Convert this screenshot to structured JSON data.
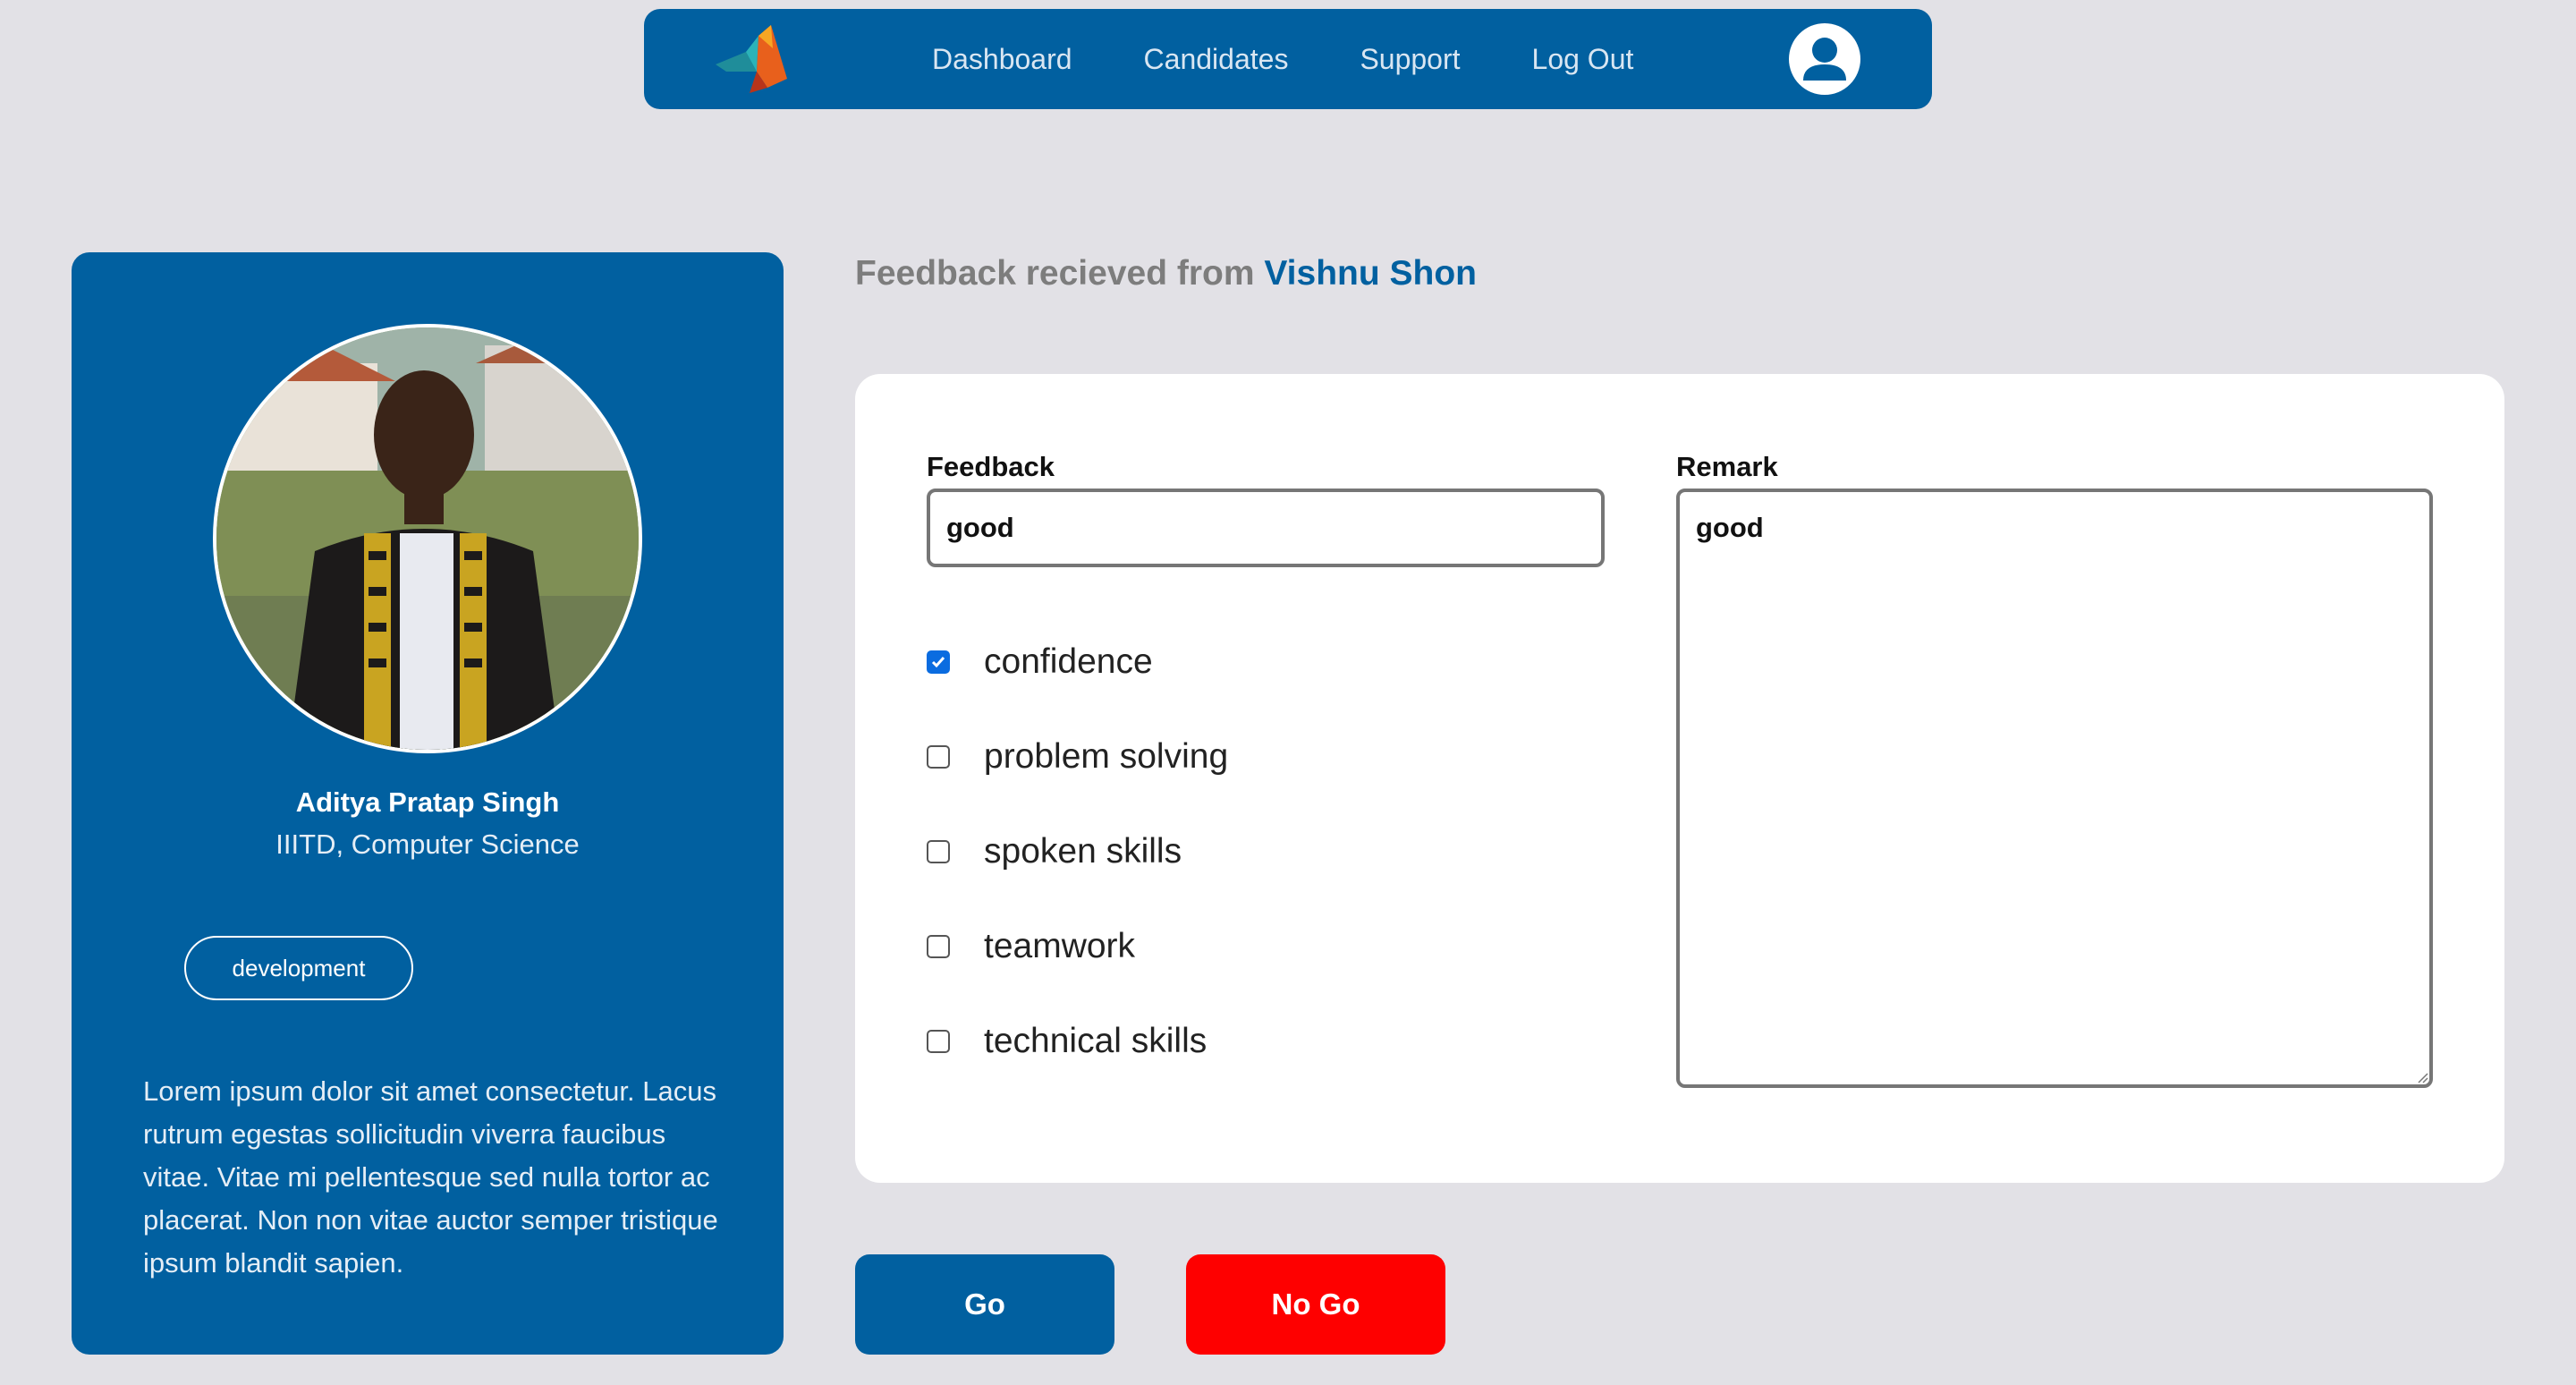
{
  "nav": {
    "links": [
      "Dashboard",
      "Candidates",
      "Support",
      "Log Out"
    ]
  },
  "profile": {
    "name": "Aditya Pratap Singh",
    "school": "IIITD, Computer Science",
    "tag": "development",
    "bio": "Lorem ipsum dolor sit amet consectetur. Lacus rutrum egestas sollicitudin viverra faucibus vitae. Vitae mi pellentesque sed nulla tortor ac placerat. Non non vitae auctor semper tristique ipsum blandit sapien."
  },
  "heading": {
    "prefix": "Feedback recieved from ",
    "interviewer": "Vishnu Shon"
  },
  "form": {
    "feedback_label": "Feedback",
    "feedback_value": "good",
    "remark_label": "Remark",
    "remark_value": "good",
    "skills": [
      {
        "label": "confidence",
        "checked": true
      },
      {
        "label": "problem solving",
        "checked": false
      },
      {
        "label": "spoken skills",
        "checked": false
      },
      {
        "label": "teamwork",
        "checked": false
      },
      {
        "label": "technical skills",
        "checked": false
      }
    ]
  },
  "buttons": {
    "go": "Go",
    "no_go": "No Go"
  },
  "colors": {
    "primary": "#0160a0",
    "danger": "#fe0000",
    "background": "#e2e1e6",
    "checkbox_checked": "#0a6ce0"
  }
}
